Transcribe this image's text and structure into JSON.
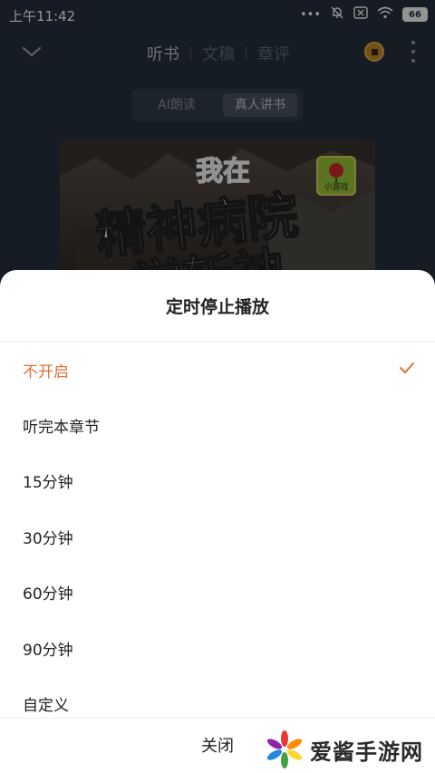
{
  "status_bar": {
    "time": "上午11:42",
    "battery": "66"
  },
  "header": {
    "tabs": [
      "听书",
      "文稿",
      "章评"
    ],
    "active_tab": 0
  },
  "segment": {
    "options": [
      "AI朗读",
      "真人讲书"
    ],
    "selected": 1
  },
  "cover": {
    "badge": "小游戏",
    "title_lines": [
      "我在",
      "精神病院",
      "学斩神"
    ]
  },
  "sheet": {
    "title": "定时停止播放",
    "options": [
      {
        "label": "不开启",
        "selected": true
      },
      {
        "label": "听完本章节",
        "selected": false
      },
      {
        "label": "15分钟",
        "selected": false
      },
      {
        "label": "30分钟",
        "selected": false
      },
      {
        "label": "60分钟",
        "selected": false
      },
      {
        "label": "90分钟",
        "selected": false
      },
      {
        "label": "自定义",
        "selected": false
      }
    ],
    "close_label": "关闭"
  },
  "watermark": {
    "text": "爱酱手游网"
  },
  "colors": {
    "accent": "#e0713b",
    "background": "#27313d"
  }
}
